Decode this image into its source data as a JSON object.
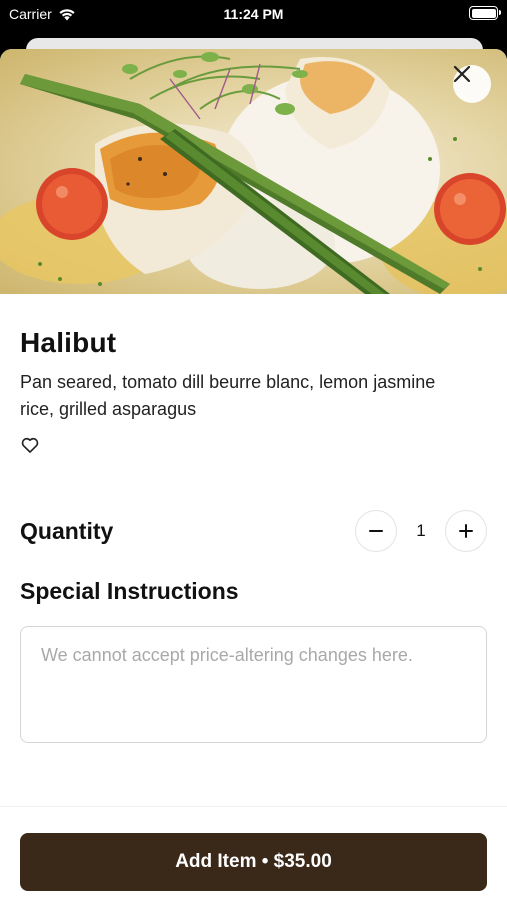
{
  "status_bar": {
    "carrier": "Carrier",
    "time": "11:24 PM"
  },
  "item": {
    "name": "Halibut",
    "description": "Pan seared, tomato dill beurre blanc, lemon jasmine rice, grilled asparagus",
    "image_alt": "Plated halibut with asparagus, rice and tomatoes"
  },
  "quantity": {
    "label": "Quantity",
    "value": "1",
    "decrement_symbol": "−",
    "increment_symbol": "+"
  },
  "special_instructions": {
    "label": "Special Instructions",
    "placeholder": "We cannot accept price-altering changes here.",
    "value": ""
  },
  "footer": {
    "add_button_label": "Add Item • $35.00"
  },
  "icons": {
    "close": "close-icon",
    "favorite": "heart-icon",
    "wifi": "wifi-icon",
    "battery": "battery-icon"
  },
  "colors": {
    "primary_button": "#3a2818",
    "text": "#111111",
    "border": "#d6d6d6"
  }
}
